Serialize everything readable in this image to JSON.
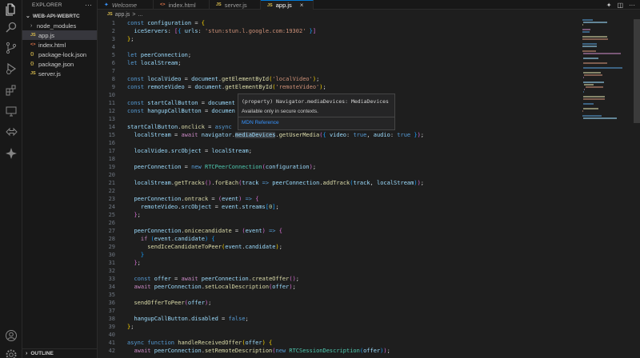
{
  "sidebar": {
    "title": "EXPLORER",
    "more": "···",
    "folder": "WEB-API-WEBRTC",
    "items": [
      {
        "label": "node_modules",
        "type": "folder",
        "icon": "chevron-right-icon"
      },
      {
        "label": "app.js",
        "type": "js",
        "icon_text": "JS",
        "active": true
      },
      {
        "label": "index.html",
        "type": "html",
        "icon_text": "<>"
      },
      {
        "label": "package-lock.json",
        "type": "json",
        "icon_text": "{}"
      },
      {
        "label": "package.json",
        "type": "json",
        "icon_text": "{}"
      },
      {
        "label": "server.js",
        "type": "js",
        "icon_text": "JS"
      }
    ],
    "outline": "OUTLINE"
  },
  "tabs": [
    {
      "label": "Welcome",
      "icon_text": "",
      "italic": true
    },
    {
      "label": "index.html",
      "icon_text": "<>"
    },
    {
      "label": "server.js",
      "icon_text": "JS"
    },
    {
      "label": "app.js",
      "icon_text": "JS",
      "active": true,
      "close": "×"
    }
  ],
  "breadcrumb": {
    "icon_text": "JS",
    "file": "app.js",
    "sep": ">",
    "rest": "..."
  },
  "editor": {
    "lines": [
      {
        "n": "1",
        "html": "<span class='k'>const</span> <span class='v'>configuration</span> <span class='p'>=</span> <span class='b1'>{</span>"
      },
      {
        "n": "2",
        "html": "  <span class='v'>iceServers</span><span class='p'>:</span> <span class='b2'>[</span><span class='b3'>{</span> <span class='v'>urls</span><span class='p'>:</span> <span class='s'>'stun:stun.l.google.com:19302'</span> <span class='b3'>}</span><span class='b2'>]</span>"
      },
      {
        "n": "3",
        "html": "<span class='b1'>}</span><span class='p'>;</span>"
      },
      {
        "n": "4",
        "html": ""
      },
      {
        "n": "5",
        "html": "<span class='k'>let</span> <span class='v'>peerConnection</span><span class='p'>;</span>"
      },
      {
        "n": "6",
        "html": "<span class='k'>let</span> <span class='v'>localStream</span><span class='p'>;</span>"
      },
      {
        "n": "7",
        "html": ""
      },
      {
        "n": "8",
        "html": "<span class='k'>const</span> <span class='v'>localVideo</span> <span class='p'>=</span> <span class='v'>document</span><span class='p'>.</span><span class='f'>getElementById</span><span class='b1'>(</span><span class='s'>'localVideo'</span><span class='b1'>)</span><span class='p'>;</span>"
      },
      {
        "n": "9",
        "html": "<span class='k'>const</span> <span class='v'>remoteVideo</span> <span class='p'>=</span> <span class='v'>document</span><span class='p'>.</span><span class='f'>getElementById</span><span class='b1'>(</span><span class='s'>'remoteVideo'</span><span class='b1'>)</span><span class='p'>;</span>"
      },
      {
        "n": "10",
        "html": ""
      },
      {
        "n": "11",
        "html": "<span class='k'>const</span> <span class='v'>startCallButton</span> <span class='p'>=</span> <span class='v'>document</span>"
      },
      {
        "n": "12",
        "html": "<span class='k'>const</span> <span class='v'>hangupCallButton</span> <span class='p'>=</span> <span class='v'>documen</span>"
      },
      {
        "n": "13",
        "html": ""
      },
      {
        "n": "14",
        "html": "<span class='v'>startCallButton</span><span class='p'>.</span><span class='f'>onclick</span> <span class='p'>=</span> <span class='k'>async</span>"
      },
      {
        "n": "15",
        "html": "  <span class='v'>localStream</span> <span class='p'>=</span> <span class='c'>await</span> <span class='v'>navigator</span><span class='p'>.</span><span class='v hl'>mediaDevices</span><span class='p'>.</span><span class='f'>getUserMedia</span><span class='b2'>(</span><span class='b3'>{</span> <span class='v'>video</span><span class='p'>:</span> <span class='k'>true</span><span class='p'>,</span> <span class='v'>audio</span><span class='p'>:</span> <span class='k'>true</span> <span class='b3'>}</span><span class='b2'>)</span><span class='p'>;</span>"
      },
      {
        "n": "16",
        "html": ""
      },
      {
        "n": "17",
        "html": "  <span class='v'>localVideo</span><span class='p'>.</span><span class='v'>srcObject</span> <span class='p'>=</span> <span class='v'>localStream</span><span class='p'>;</span>"
      },
      {
        "n": "18",
        "html": ""
      },
      {
        "n": "19",
        "html": "  <span class='v'>peerConnection</span> <span class='p'>=</span> <span class='k'>new</span> <span class='t'>RTCPeerConnection</span><span class='b2'>(</span><span class='v'>configuration</span><span class='b2'>)</span><span class='p'>;</span>"
      },
      {
        "n": "20",
        "html": ""
      },
      {
        "n": "21",
        "html": "  <span class='v'>localStream</span><span class='p'>.</span><span class='f'>getTracks</span><span class='b2'>()</span><span class='p'>.</span><span class='f'>forEach</span><span class='b2'>(</span><span class='v'>track</span> <span class='k'>=&gt;</span> <span class='v'>peerConnection</span><span class='p'>.</span><span class='f'>addTrack</span><span class='b3'>(</span><span class='v'>track</span><span class='p'>,</span> <span class='v'>localStream</span><span class='b3'>)</span><span class='b2'>)</span><span class='p'>;</span>"
      },
      {
        "n": "22",
        "html": ""
      },
      {
        "n": "23",
        "html": "  <span class='v'>peerConnection</span><span class='p'>.</span><span class='f'>ontrack</span> <span class='p'>=</span> <span class='b2'>(</span><span class='v'>event</span><span class='b2'>)</span> <span class='k'>=&gt;</span> <span class='b2'>{</span>"
      },
      {
        "n": "24",
        "html": "    <span class='v'>remoteVideo</span><span class='p'>.</span><span class='v'>srcObject</span> <span class='p'>=</span> <span class='v'>event</span><span class='p'>.</span><span class='v'>streams</span><span class='b3'>[</span><span class='n'>0</span><span class='b3'>]</span><span class='p'>;</span>"
      },
      {
        "n": "25",
        "html": "  <span class='b2'>}</span><span class='p'>;</span>"
      },
      {
        "n": "26",
        "html": ""
      },
      {
        "n": "27",
        "html": "  <span class='v'>peerConnection</span><span class='p'>.</span><span class='f'>onicecandidate</span> <span class='p'>=</span> <span class='b2'>(</span><span class='v'>event</span><span class='b2'>)</span> <span class='k'>=&gt;</span> <span class='b2'>{</span>"
      },
      {
        "n": "28",
        "html": "    <span class='c'>if</span> <span class='b3'>(</span><span class='v'>event</span><span class='p'>.</span><span class='v'>candidate</span><span class='b3'>)</span> <span class='b3'>{</span>"
      },
      {
        "n": "29",
        "html": "      <span class='f'>sendIceCandidateToPeer</span><span class='b1'>(</span><span class='v'>event</span><span class='p'>.</span><span class='v'>candidate</span><span class='b1'>)</span><span class='p'>;</span>"
      },
      {
        "n": "30",
        "html": "    <span class='b3'>}</span>"
      },
      {
        "n": "31",
        "html": "  <span class='b2'>}</span><span class='p'>;</span>"
      },
      {
        "n": "32",
        "html": ""
      },
      {
        "n": "33",
        "html": "  <span class='k'>const</span> <span class='v'>offer</span> <span class='p'>=</span> <span class='c'>await</span> <span class='v'>peerConnection</span><span class='p'>.</span><span class='f'>createOffer</span><span class='b2'>()</span><span class='p'>;</span>"
      },
      {
        "n": "34",
        "html": "  <span class='c'>await</span> <span class='v'>peerConnection</span><span class='p'>.</span><span class='f'>setLocalDescription</span><span class='b2'>(</span><span class='v'>offer</span><span class='b2'>)</span><span class='p'>;</span>"
      },
      {
        "n": "35",
        "html": ""
      },
      {
        "n": "36",
        "html": "  <span class='f'>sendOfferToPeer</span><span class='b2'>(</span><span class='v'>offer</span><span class='b2'>)</span><span class='p'>;</span>"
      },
      {
        "n": "37",
        "html": ""
      },
      {
        "n": "38",
        "html": "  <span class='v'>hangupCallButton</span><span class='p'>.</span><span class='v'>disabled</span> <span class='p'>=</span> <span class='k'>false</span><span class='p'>;</span>"
      },
      {
        "n": "39",
        "html": "<span class='b1'>}</span><span class='p'>;</span>"
      },
      {
        "n": "40",
        "html": ""
      },
      {
        "n": "41",
        "html": "<span class='k'>async</span> <span class='k'>function</span> <span class='f'>handleReceivedOffer</span><span class='b1'>(</span><span class='v'>offer</span><span class='b1'>)</span> <span class='b1'>{</span>"
      },
      {
        "n": "42",
        "html": "  <span class='c'>await</span> <span class='v'>peerConnection</span><span class='p'>.</span><span class='f'>setRemoteDescription</span><span class='b2'>(</span><span class='k'>new</span> <span class='t'>RTCSessionDescription</span><span class='b3'>(</span><span class='v'>offer</span><span class='b3'>)</span><span class='b2'>)</span><span class='p'>;</span>"
      }
    ]
  },
  "hover": {
    "signature": "(property) Navigator.mediaDevices: MediaDevices",
    "description": "Available only in secure contexts.",
    "link": "MDN Reference"
  },
  "activity_icons": [
    "files-icon",
    "search-icon",
    "source-control-icon",
    "run-debug-icon",
    "extensions-icon",
    "remote-explorer-icon",
    "live-share-icon",
    "copilot-icon",
    "account-icon",
    "settings-icon"
  ],
  "colors": {
    "accent": "#0078d4",
    "editor_bg": "#1e1e1e",
    "sidebar_bg": "#181818"
  }
}
